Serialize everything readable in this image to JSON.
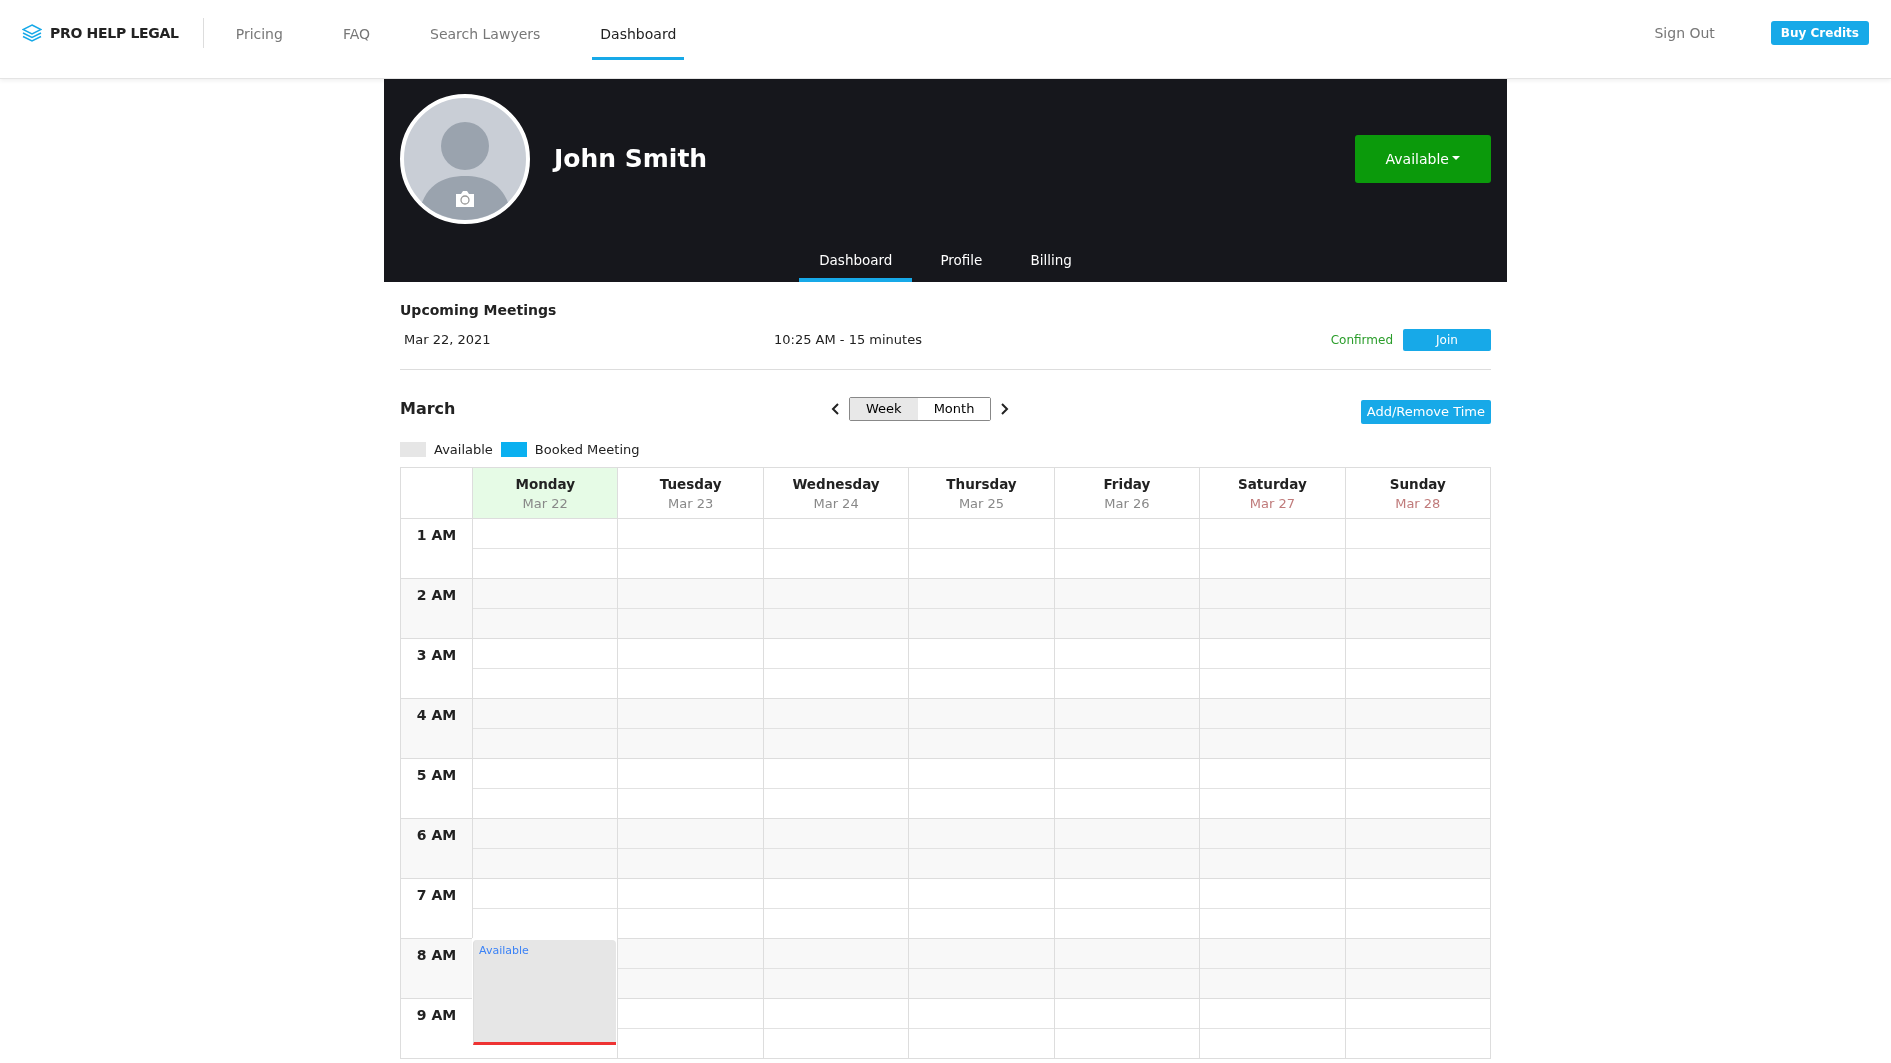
{
  "nav": {
    "brand": "PRO HELP LEGAL",
    "links": [
      {
        "label": "Pricing",
        "selected": false
      },
      {
        "label": "FAQ",
        "selected": false
      },
      {
        "label": "Search Lawyers",
        "selected": false
      },
      {
        "label": "Dashboard",
        "selected": true
      }
    ],
    "sign_out": "Sign Out",
    "buy_credits": "Buy Credits"
  },
  "profile": {
    "name": "John Smith",
    "status_button": "Available",
    "tabs": [
      {
        "label": "Dashboard",
        "selected": true
      },
      {
        "label": "Profile",
        "selected": false
      },
      {
        "label": "Billing",
        "selected": false
      }
    ]
  },
  "upcoming": {
    "title": "Upcoming Meetings",
    "meetings": [
      {
        "date": "Mar 22, 2021",
        "time": "10:25 AM - 15 minutes",
        "status": "Confirmed",
        "action": "Join"
      }
    ]
  },
  "calendar": {
    "month": "March",
    "views": [
      {
        "label": "Week",
        "selected": true
      },
      {
        "label": "Month",
        "selected": false
      }
    ],
    "add_button": "Add/Remove Time",
    "legend": [
      {
        "label": "Available",
        "color": "#e6e6e6"
      },
      {
        "label": "Booked Meeting",
        "color": "#0ab0f0"
      }
    ],
    "days": [
      {
        "name": "Monday",
        "date": "Mar 22",
        "selected": true,
        "weekend": false
      },
      {
        "name": "Tuesday",
        "date": "Mar 23",
        "selected": false,
        "weekend": false
      },
      {
        "name": "Wednesday",
        "date": "Mar 24",
        "selected": false,
        "weekend": false
      },
      {
        "name": "Thursday",
        "date": "Mar 25",
        "selected": false,
        "weekend": false
      },
      {
        "name": "Friday",
        "date": "Mar 26",
        "selected": false,
        "weekend": false
      },
      {
        "name": "Saturday",
        "date": "Mar 27",
        "selected": false,
        "weekend": true
      },
      {
        "name": "Sunday",
        "date": "Mar 28",
        "selected": false,
        "weekend": true
      }
    ],
    "hours": [
      {
        "label": "1 AM"
      },
      {
        "label": "2 AM"
      },
      {
        "label": "3 AM"
      },
      {
        "label": "4 AM"
      },
      {
        "label": "5 AM"
      },
      {
        "label": "6 AM"
      },
      {
        "label": "7 AM"
      },
      {
        "label": "8 AM",
        "slots": [
          {
            "kind": "available",
            "label": "Available",
            "current_time_line": true
          },
          {
            "kind": "empty"
          },
          {
            "kind": "empty"
          },
          {
            "kind": "empty"
          },
          {
            "kind": "empty"
          },
          {
            "kind": "empty"
          },
          {
            "kind": "empty"
          }
        ]
      },
      {
        "label": "9 AM"
      }
    ]
  }
}
